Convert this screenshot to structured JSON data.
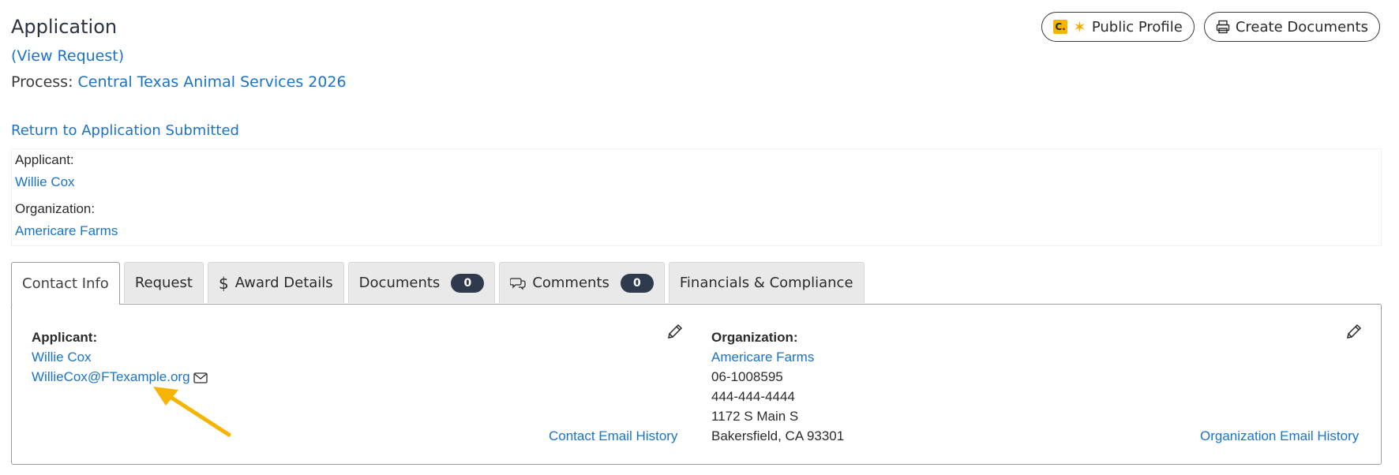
{
  "header": {
    "title": "Application",
    "view_request": "(View Request)",
    "process_label": "Process: ",
    "process_value": "Central Texas Animal Services 2026",
    "return_link": "Return to Application Submitted"
  },
  "actions": {
    "public_profile": "Public Profile",
    "public_profile_badge": "C.",
    "create_documents": "Create Documents"
  },
  "summary": {
    "applicant_label": "Applicant:",
    "applicant_name": "Willie Cox",
    "organization_label": "Organization:",
    "organization_name": "Americare Farms"
  },
  "tabs": [
    {
      "label": "Contact Info",
      "active": true
    },
    {
      "label": "Request"
    },
    {
      "label": "Award Details",
      "icon": "dollar-icon"
    },
    {
      "label": "Documents",
      "count": "0"
    },
    {
      "label": "Comments",
      "count": "0",
      "icon": "comments-icon"
    },
    {
      "label": "Financials & Compliance"
    }
  ],
  "contact": {
    "applicant_label": "Applicant:",
    "applicant_name": "Willie Cox",
    "applicant_email": "WillieCox@FTexample.org",
    "contact_email_history": "Contact Email History",
    "organization_label": "Organization:",
    "organization_name": "Americare Farms",
    "org_ein": "06-1008595",
    "org_phone": "444-444-4444",
    "org_address1": "1172 S Main S",
    "org_address2": "Bakersfield, CA 93301",
    "org_email_history": "Organization Email History"
  },
  "colors": {
    "link": "#1a73c8",
    "badge_dark": "#2f3b4c",
    "arrow": "#f5b400"
  }
}
